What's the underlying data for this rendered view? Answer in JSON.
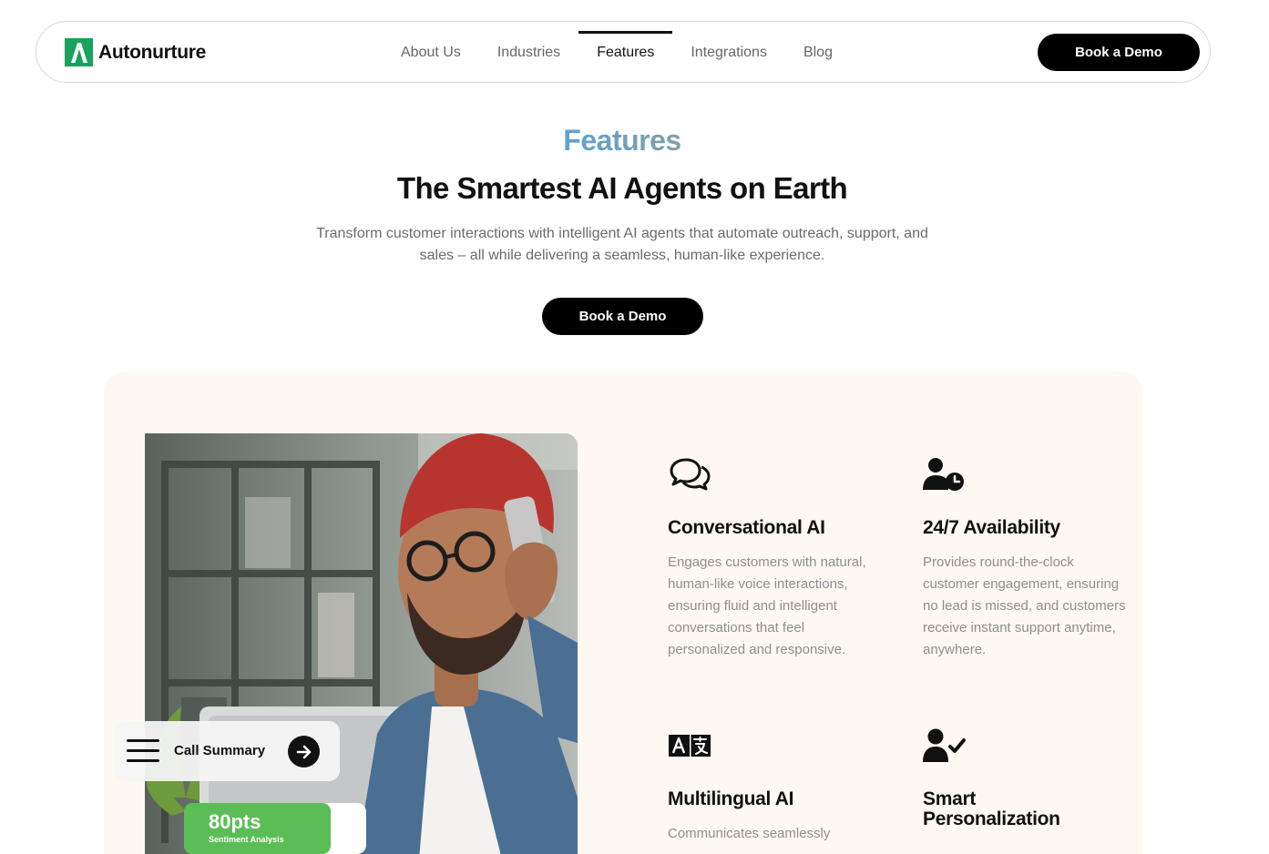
{
  "nav": {
    "brand": "Autonurture",
    "links": [
      {
        "label": "About Us",
        "active": false
      },
      {
        "label": "Industries",
        "active": false
      },
      {
        "label": "Features",
        "active": true
      },
      {
        "label": "Integrations",
        "active": false
      },
      {
        "label": "Blog",
        "active": false
      }
    ],
    "cta": "Book a Demo"
  },
  "hero": {
    "eyebrow": "Features",
    "title": "The Smartest AI Agents on Earth",
    "subtitle": "Transform customer interactions with intelligent AI agents that automate outreach, support, and sales – all while delivering a seamless, human-like experience.",
    "cta": "Book a Demo"
  },
  "overlay": {
    "call_summary": "Call Summary",
    "score": "80pts",
    "score_label": "Sentiment Analysis"
  },
  "features": [
    {
      "icon": "chat-bubbles-icon",
      "title": "Conversational AI",
      "text": "Engages customers with natural, human-like voice interactions, ensuring fluid and intelligent conversations that feel personalized and responsive."
    },
    {
      "icon": "user-clock-icon",
      "title": "24/7 Availability",
      "text": "Provides round-the-clock customer engagement, ensuring no lead is missed, and customers receive instant support anytime, anywhere."
    },
    {
      "icon": "translate-icon",
      "title": "Multilingual AI",
      "text": "Communicates seamlessly"
    },
    {
      "icon": "user-check-icon",
      "title": "Smart Personalization",
      "text": ""
    }
  ],
  "colors": {
    "brand_green": "#17a35d",
    "panel_bg": "#fdf9f2",
    "score_green": "#5bbd55",
    "cta_black": "#000000"
  }
}
